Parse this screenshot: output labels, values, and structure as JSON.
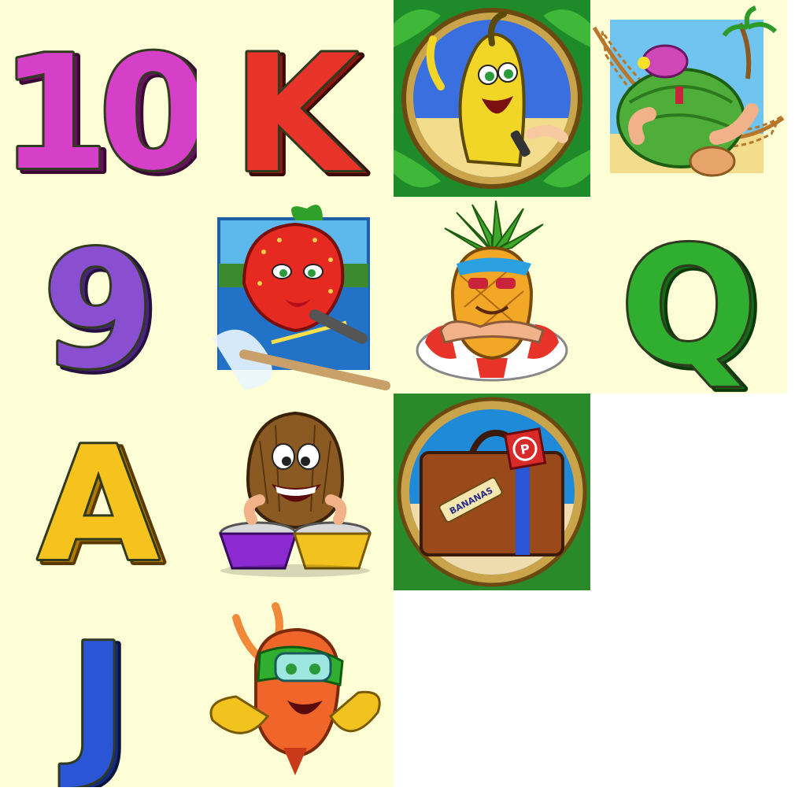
{
  "sprite_sheet": {
    "background": "#fdfdd6",
    "card_symbols": [
      {
        "id": "ten",
        "label": "10",
        "color": "#d63fc8",
        "shade": "#8a1e80"
      },
      {
        "id": "king",
        "label": "K",
        "color": "#e8332a",
        "shade": "#8e1712"
      },
      {
        "id": "nine",
        "label": "9",
        "color": "#8a4fd0",
        "shade": "#4b2280"
      },
      {
        "id": "queen",
        "label": "Q",
        "color": "#2fae2f",
        "shade": "#156a15"
      },
      {
        "id": "ace",
        "label": "A",
        "color": "#f6c21e",
        "shade": "#b07a00"
      },
      {
        "id": "jack",
        "label": "J",
        "color": "#2a56d6",
        "shade": "#142a80"
      }
    ],
    "character_symbols": [
      {
        "id": "banana",
        "icon": "banana-wild-icon"
      },
      {
        "id": "watermelon",
        "icon": "watermelon-hammock-icon"
      },
      {
        "id": "strawberry",
        "icon": "strawberry-waterski-icon"
      },
      {
        "id": "pineapple",
        "icon": "pineapple-lifering-icon"
      },
      {
        "id": "coconut",
        "icon": "coconut-bongo-icon"
      },
      {
        "id": "suitcase",
        "icon": "suitcase-scatter-icon",
        "tag_text": "BANANAS",
        "badge_text": "P"
      },
      {
        "id": "mango",
        "icon": "mango-snorkel-icon"
      }
    ]
  }
}
